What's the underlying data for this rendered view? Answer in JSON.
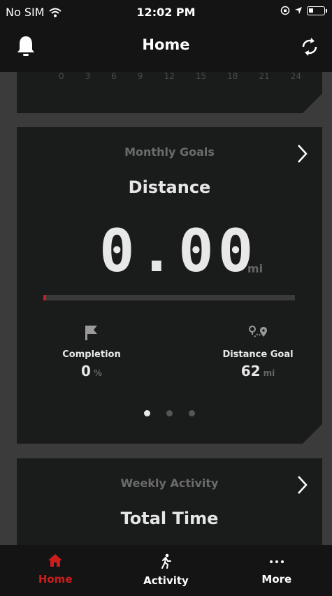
{
  "status_bar": {
    "carrier": "No SIM",
    "time": "12:02 PM"
  },
  "header": {
    "title": "Home",
    "left_icon": "bell-icon",
    "right_icon": "sync-icon"
  },
  "top_card": {
    "axis_ticks": [
      "0",
      "3",
      "6",
      "9",
      "12",
      "15",
      "18",
      "21",
      "24"
    ]
  },
  "goals_card": {
    "subtitle": "Monthly Goals",
    "title": "Distance",
    "value": "0.00",
    "unit": "mi",
    "progress_fraction": 0.01,
    "completion_label": "Completion",
    "completion_value": "0",
    "completion_unit": "%",
    "goal_label": "Distance Goal",
    "goal_value": "62",
    "goal_unit": "mi",
    "pager_count": 3,
    "pager_active": 0
  },
  "weekly_card": {
    "subtitle": "Weekly Activity",
    "title": "Total Time"
  },
  "tabbar": {
    "items": [
      {
        "label": "Home",
        "icon": "home-icon",
        "active": true
      },
      {
        "label": "Activity",
        "icon": "running-icon",
        "active": false
      },
      {
        "label": "More",
        "icon": "ellipsis-icon",
        "active": false
      }
    ]
  },
  "colors": {
    "accent": "#cc1d1d",
    "background": "#3b3b3b",
    "card": "#1a1c1b",
    "bar": "#141414"
  }
}
